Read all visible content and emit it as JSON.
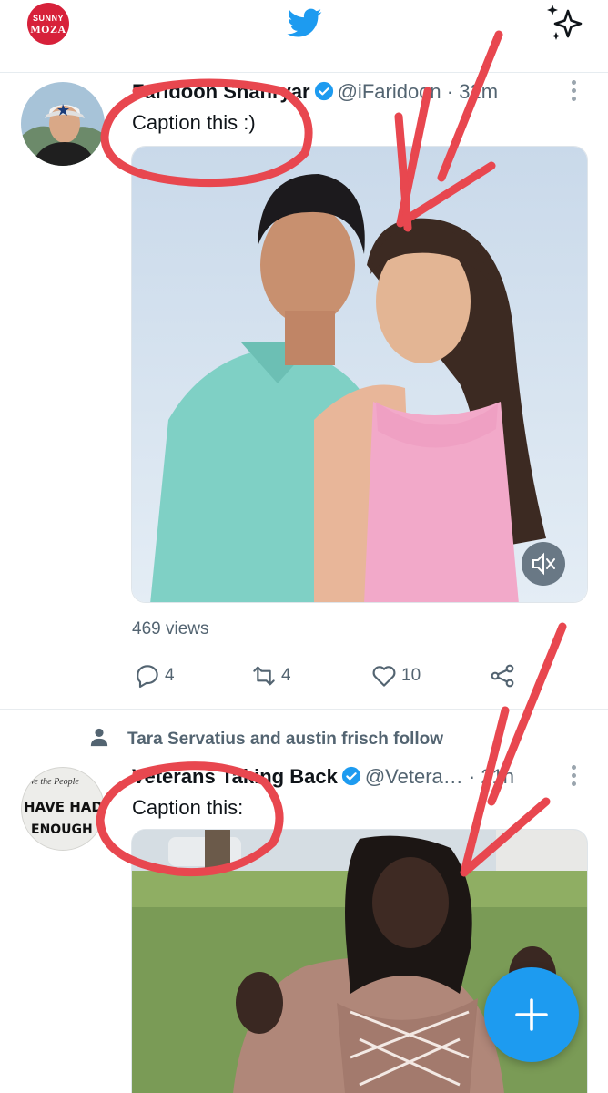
{
  "app": {
    "title": "Twitter",
    "brand_color": "#1d9bf0",
    "annotation_color": "#e8474f"
  },
  "topbar": {
    "account_avatar": {
      "line1": "SUNNY",
      "line2": "MOZA"
    },
    "logo_icon": "twitter-bird-icon",
    "timeline_icon": "sparkle-icon"
  },
  "tweets": [
    {
      "name": "Faridoon Shahryar",
      "verified": true,
      "handle": "@iFaridoon",
      "separator": "·",
      "time": "32m",
      "text": "Caption this :)",
      "views": "469 views",
      "replies": "4",
      "retweets": "4",
      "likes": "10",
      "media_type": "video"
    },
    {
      "context": "Tara Servatius and austin frisch follow",
      "name": "Veterans Taking Back",
      "verified": true,
      "handle": "@Vetera…",
      "separator": "·",
      "time": "21h",
      "text": "Caption this:",
      "avatar_text": {
        "line1": "We the People",
        "line2": "HAVE HAD",
        "line3": "ENOUGH"
      },
      "media_type": "photo"
    }
  ],
  "compose_button": {
    "icon": "plus-icon"
  }
}
